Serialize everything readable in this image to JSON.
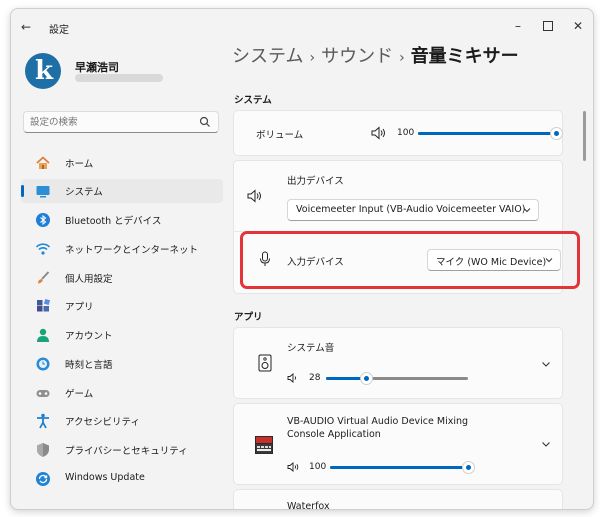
{
  "window": {
    "title": "設定",
    "back_icon": "back-arrow-icon",
    "controls": [
      "minimize",
      "maximize",
      "close"
    ]
  },
  "user": {
    "name": "早瀬浩司",
    "avatar_letter": "k"
  },
  "search": {
    "placeholder": "設定の検索",
    "value": ""
  },
  "nav": {
    "items": [
      {
        "label": "ホーム",
        "icon": "home-icon",
        "selected": false
      },
      {
        "label": "システム",
        "icon": "system-icon",
        "selected": true
      },
      {
        "label": "Bluetooth とデバイス",
        "icon": "bluetooth-icon",
        "selected": false
      },
      {
        "label": "ネットワークとインターネット",
        "icon": "network-icon",
        "selected": false
      },
      {
        "label": "個人用設定",
        "icon": "brush-icon",
        "selected": false
      },
      {
        "label": "アプリ",
        "icon": "apps-icon",
        "selected": false
      },
      {
        "label": "アカウント",
        "icon": "account-icon",
        "selected": false
      },
      {
        "label": "時刻と言語",
        "icon": "time-language-icon",
        "selected": false
      },
      {
        "label": "ゲーム",
        "icon": "gamepad-icon",
        "selected": false
      },
      {
        "label": "アクセシビリティ",
        "icon": "accessibility-icon",
        "selected": false
      },
      {
        "label": "プライバシーとセキュリティ",
        "icon": "shield-icon",
        "selected": false
      },
      {
        "label": "Windows Update",
        "icon": "update-icon",
        "selected": false
      }
    ]
  },
  "breadcrumb": {
    "level1": "システム",
    "level2": "サウンド",
    "current": "音量ミキサー",
    "separator": "›"
  },
  "system_section": {
    "label": "システム",
    "volume": {
      "label": "ボリューム",
      "value": 100
    },
    "output": {
      "label": "出力デバイス",
      "selected": "Voicemeeter Input (VB-Audio Voicemeeter VAIO)"
    },
    "input": {
      "label": "入力デバイス",
      "selected": "マイク (WO Mic Device)"
    }
  },
  "apps_section": {
    "label": "アプリ",
    "apps": [
      {
        "name": "システム音",
        "volume": 28,
        "icon": "speaker-device-icon"
      },
      {
        "name_line1": "VB-AUDIO Virtual Audio Device Mixing",
        "name_line2": "Console Application",
        "volume": 100,
        "icon": "voicemeeter-icon"
      },
      {
        "name_partial": "Waterfox"
      }
    ]
  },
  "colors": {
    "accent": "#0067c0",
    "highlight": "#e3343a",
    "background": "#f3f3f3",
    "card": "#fbfbfb"
  }
}
